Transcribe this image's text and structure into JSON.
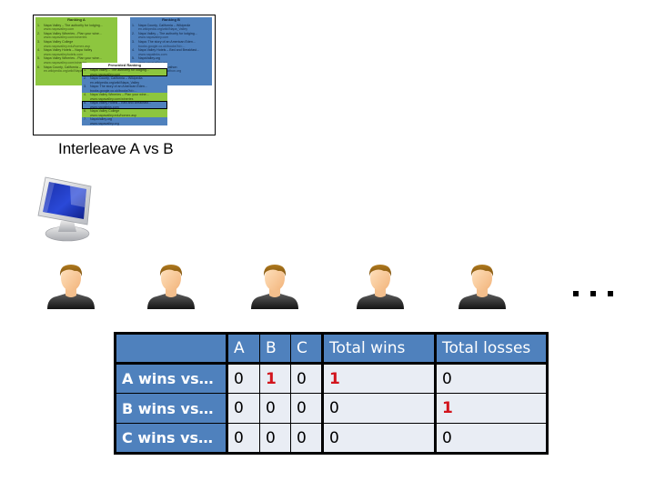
{
  "thumbnail": {
    "ranking_a": {
      "title": "Ranking A",
      "items": [
        {
          "num": "1.",
          "title": "Napa Valley – The authority for lodging...",
          "url": "www.napavalley.com"
        },
        {
          "num": "2.",
          "title": "Napa Valley Wineries - Plan your wine...",
          "url": "www.napavalley.com/wineries"
        },
        {
          "num": "3.",
          "title": "Napa Valley College",
          "url": "www.napavalley.edu/homex.asp"
        },
        {
          "num": "4.",
          "title": "Napa Valley Hotels – Napa Valley",
          "url": "www.napavalleyhotels.com"
        },
        {
          "num": "5.",
          "title": "Napa Valley Wineries - Plan your wine...",
          "url": "www.napavalley.com/wineries"
        },
        {
          "num": "6.",
          "title": "Napa County, California – Wikipedia",
          "url": "en.wikipedia.org/wiki/Napa_Valley"
        }
      ]
    },
    "ranking_b": {
      "title": "Ranking B",
      "items": [
        {
          "num": "1.",
          "title": "Napa County, California – Wikipedia",
          "url": "en.wikipedia.org/wiki/Napa_Valley"
        },
        {
          "num": "2.",
          "title": "Napa Valley – The authority for lodging...",
          "url": "www.napavalley.com"
        },
        {
          "num": "3.",
          "title": "Napa: The story of an American Eden...",
          "url": "books.google.co.uk/books?id=..."
        },
        {
          "num": "4.",
          "title": "Napa Valley Hotels – Bed and Breakfast...",
          "url": "www.napalinks.com"
        },
        {
          "num": "5.",
          "title": "NapaValley.org",
          "url": "www.napavalley.org"
        },
        {
          "num": "6.",
          "title": "The Napa Valley Marathon",
          "url": "www.napavalleymarathon.org"
        }
      ]
    },
    "presented": {
      "title": "Presented Ranking",
      "items": [
        {
          "num": "1.",
          "title": "Napa Valley – The authority for lodging...",
          "url": "www.napavalley.com",
          "source": "a",
          "clicked": true
        },
        {
          "num": "2.",
          "title": "Napa County, California – Wikipedia",
          "url": "en.wikipedia.org/wiki/Napa_Valley",
          "source": "b",
          "clicked": false
        },
        {
          "num": "3.",
          "title": "Napa: The story of an American Eden...",
          "url": "books.google.co.uk/books?id=...",
          "source": "b",
          "clicked": false
        },
        {
          "num": "4.",
          "title": "Napa Valley Wineries – Plan your wine...",
          "url": "www.napavalley.com/wineries",
          "source": "a",
          "clicked": false
        },
        {
          "num": "5.",
          "title": "Napa Valley Hotels – Bed and Breakfast...",
          "url": "www.napalinks.com",
          "source": "b",
          "clicked": true
        },
        {
          "num": "6.",
          "title": "Napa Valley College",
          "url": "www.napavalley.edu/homex.asp",
          "source": "a",
          "clicked": false
        },
        {
          "num": "7.",
          "title": "NapaValley.org",
          "url": "www.napavalley.org",
          "source": "b",
          "clicked": false
        }
      ]
    }
  },
  "label": "Interleave A vs B",
  "icons": {
    "monitor": "computer-monitor-icon",
    "user": "user-icon",
    "ellipsis": "ellipsis"
  },
  "user_count": 5,
  "table": {
    "headers": [
      "",
      "A",
      "B",
      "C",
      "Total wins",
      "Total losses"
    ],
    "rows": [
      {
        "label": "A wins vs…",
        "values": [
          "0",
          "1",
          "0",
          "1",
          "0"
        ],
        "highlight": [
          false,
          true,
          false,
          true,
          false
        ]
      },
      {
        "label": "B wins vs…",
        "values": [
          "0",
          "0",
          "0",
          "0",
          "1"
        ],
        "highlight": [
          false,
          false,
          false,
          false,
          true
        ]
      },
      {
        "label": "C wins vs…",
        "values": [
          "0",
          "0",
          "0",
          "0",
          "0"
        ],
        "highlight": [
          false,
          false,
          false,
          false,
          false
        ]
      }
    ]
  },
  "colors": {
    "ranking_a": "#8dc63f",
    "ranking_b": "#4f81bd",
    "table_header": "#4f81bd",
    "table_cell": "#e9edf4",
    "highlight": "#d2141c"
  }
}
